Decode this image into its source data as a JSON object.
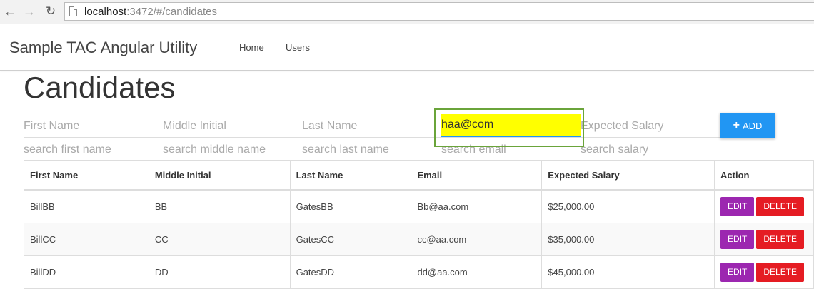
{
  "browser": {
    "url_host": "localhost",
    "url_path": ":3472/#/candidates"
  },
  "navbar": {
    "brand": "Sample TAC Angular Utility",
    "links": [
      "Home",
      "Users"
    ]
  },
  "page": {
    "title": "Candidates"
  },
  "form": {
    "first_name": "First Name",
    "middle_initial": "Middle Initial",
    "last_name": "Last Name",
    "email_value": "haa@com",
    "expected_salary": "Expected Salary",
    "add_label": "ADD"
  },
  "search": {
    "first_name": "search first name",
    "middle_name": "search middle name",
    "last_name": "search last name",
    "email": "search email",
    "salary": "search salary"
  },
  "table": {
    "headers": [
      "First Name",
      "Middle Initial",
      "Last Name",
      "Email",
      "Expected Salary",
      "Action"
    ],
    "rows": [
      [
        "BillBB",
        "BB",
        "GatesBB",
        "Bb@aa.com",
        "$25,000.00"
      ],
      [
        "BillCC",
        "CC",
        "GatesCC",
        "cc@aa.com",
        "$35,000.00"
      ],
      [
        "BillDD",
        "DD",
        "GatesDD",
        "dd@aa.com",
        "$45,000.00"
      ]
    ],
    "edit_label": "EDIT",
    "delete_label": "DELETE"
  },
  "colors": {
    "add": "#2196f3",
    "edit": "#9c27b0",
    "delete": "#e51c23",
    "highlight": "#ffff00",
    "focus_box": "#6aa43a"
  }
}
